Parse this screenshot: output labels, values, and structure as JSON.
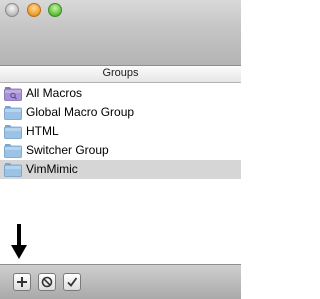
{
  "window": {
    "traffic_lights": [
      "close",
      "minimize",
      "zoom"
    ]
  },
  "header": {
    "title": "Groups"
  },
  "groups": [
    {
      "label": "All Macros",
      "icon": "smart-folder-icon",
      "selected": false
    },
    {
      "label": "Global Macro Group",
      "icon": "folder-icon",
      "selected": false
    },
    {
      "label": "HTML",
      "icon": "folder-icon",
      "selected": false
    },
    {
      "label": "Switcher Group",
      "icon": "folder-icon",
      "selected": false
    },
    {
      "label": "VimMimic",
      "icon": "folder-icon",
      "selected": true
    }
  ],
  "toolbar": {
    "buttons": [
      {
        "icon": "plus-icon"
      },
      {
        "icon": "disable-icon"
      },
      {
        "icon": "checkmark-icon"
      }
    ]
  },
  "colors": {
    "folder_blue": "#8fb8dc",
    "smart_folder_purple": "#9b86c9",
    "selected_row": "#d6d6d6"
  }
}
